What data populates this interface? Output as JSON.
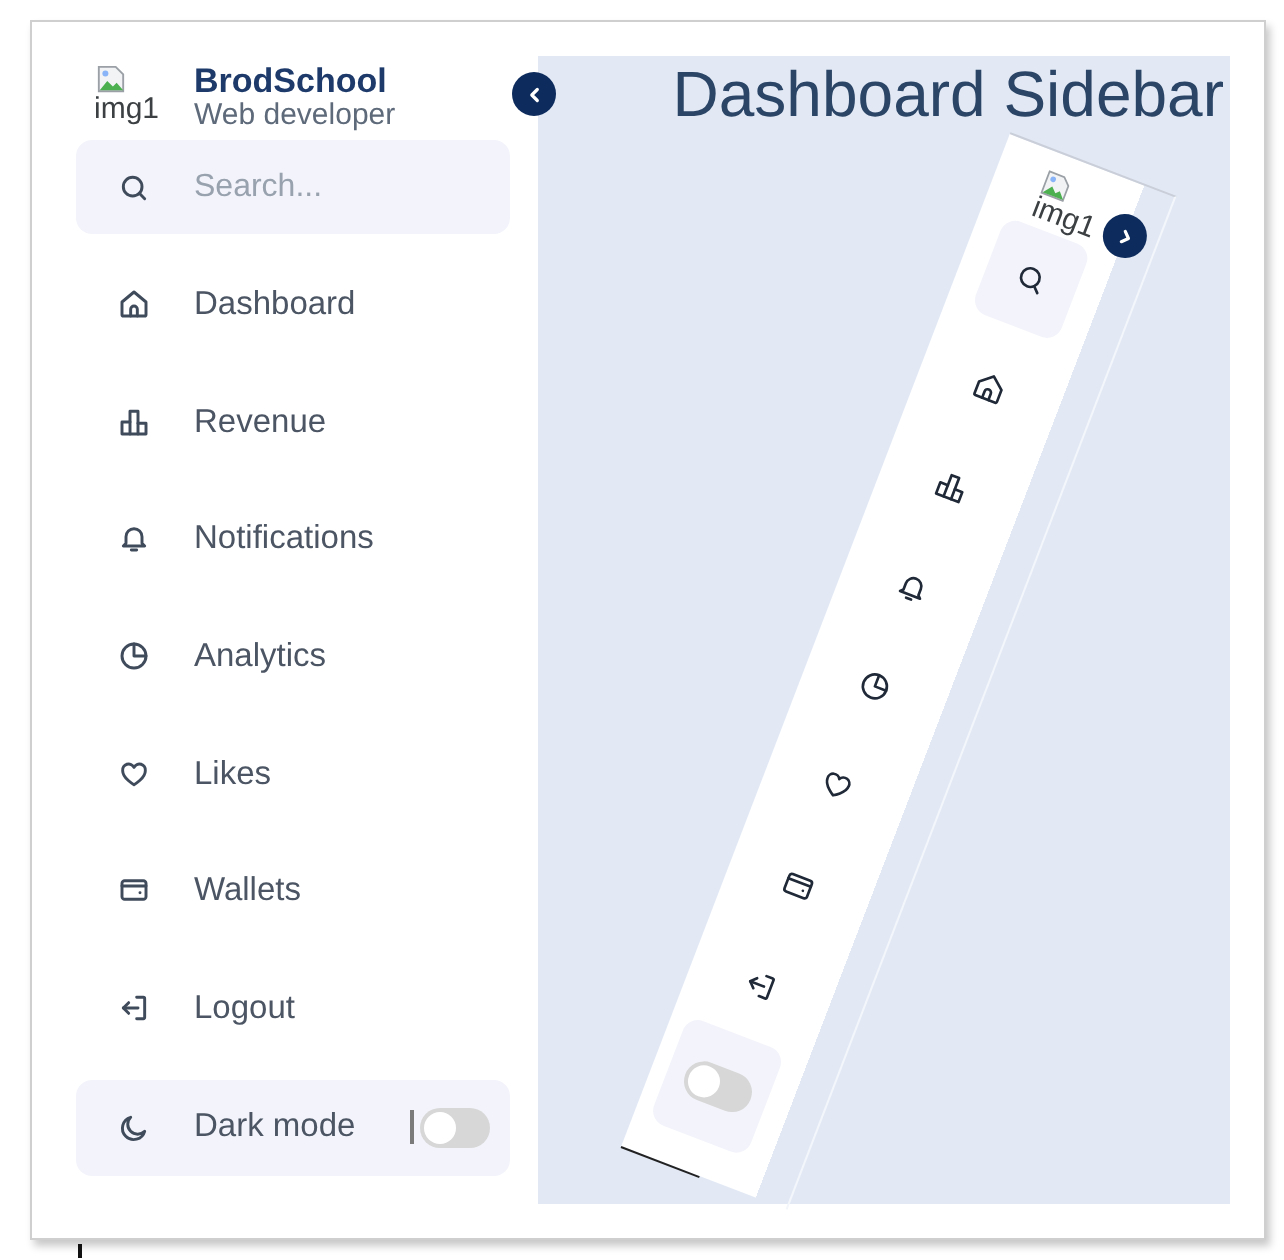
{
  "sidebar": {
    "avatar_alt": "img1",
    "name": "BrodSchool",
    "role": "Web developer",
    "collapsed": false,
    "search": {
      "placeholder": "Search..."
    },
    "items": [
      {
        "label": "Dashboard",
        "selected": false
      },
      {
        "label": "Revenue",
        "selected": false
      },
      {
        "label": "Notifications",
        "selected": false
      },
      {
        "label": "Analytics",
        "selected": false
      },
      {
        "label": "Likes",
        "selected": false
      },
      {
        "label": "Wallets",
        "selected": false
      },
      {
        "label": "Logout",
        "selected": false
      }
    ],
    "dark_mode": {
      "label": "Dark mode",
      "on": false
    }
  },
  "content": {
    "title": "Dashboard Sidebar",
    "preview": {
      "avatar_alt": "img1",
      "collapsed": true,
      "dark_mode": {
        "on": false
      }
    }
  }
}
